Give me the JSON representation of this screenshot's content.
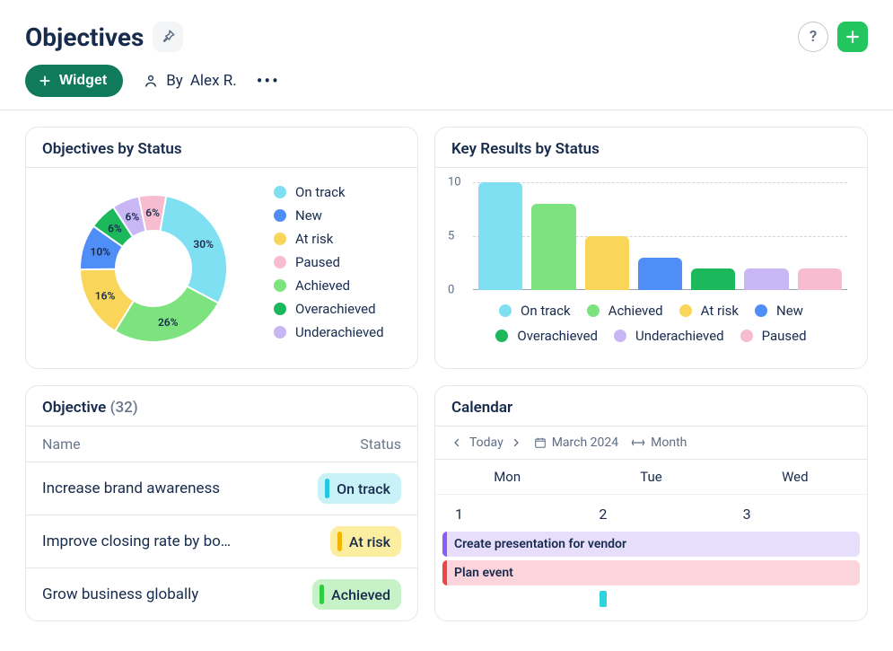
{
  "title": "Objectives",
  "toolbar": {
    "widget_label": "Widget",
    "by_prefix": "By",
    "by_user": "Alex R."
  },
  "colors": {
    "on_track": "#7ee0f0",
    "new": "#4f8df7",
    "at_risk": "#f9d65a",
    "paused": "#f7bcd0",
    "achieved": "#7ce37f",
    "overachieved": "#1cb85c",
    "underachieved": "#c9b6f5"
  },
  "pill_bg": {
    "on_track": "#c8f2f8",
    "at_risk": "#fceea0",
    "achieved": "#c7f2c8"
  },
  "pill_bar": {
    "on_track": "#22c9de",
    "at_risk": "#f5b400",
    "achieved": "#2ecc40"
  },
  "chart_data": [
    {
      "type": "pie",
      "title": "Objectives by Status",
      "series": [
        {
          "name": "On track",
          "value": 30,
          "color_key": "on_track"
        },
        {
          "name": "Achieved",
          "value": 26,
          "color_key": "achieved"
        },
        {
          "name": "At risk",
          "value": 16,
          "color_key": "at_risk"
        },
        {
          "name": "New",
          "value": 10,
          "color_key": "new"
        },
        {
          "name": "Overachieved",
          "value": 6,
          "color_key": "overachieved"
        },
        {
          "name": "Underachieved",
          "value": 6,
          "color_key": "underachieved"
        },
        {
          "name": "Paused",
          "value": 6,
          "color_key": "paused"
        }
      ],
      "legend_order": [
        "on_track",
        "new",
        "at_risk",
        "paused",
        "achieved",
        "overachieved",
        "underachieved"
      ],
      "legend_labels": {
        "on_track": "On track",
        "new": "New",
        "at_risk": "At risk",
        "paused": "Paused",
        "achieved": "Achieved",
        "overachieved": "Overachieved",
        "underachieved": "Underachieved"
      }
    },
    {
      "type": "bar",
      "title": "Key Results by Status",
      "ylim": [
        0,
        10
      ],
      "yticks": [
        0,
        5,
        10
      ],
      "series": [
        {
          "name": "On track",
          "value": 10,
          "color_key": "on_track"
        },
        {
          "name": "Achieved",
          "value": 8,
          "color_key": "achieved"
        },
        {
          "name": "At risk",
          "value": 5,
          "color_key": "at_risk"
        },
        {
          "name": "New",
          "value": 3,
          "color_key": "new"
        },
        {
          "name": "Overachieved",
          "value": 2,
          "color_key": "overachieved"
        },
        {
          "name": "Underachieved",
          "value": 2,
          "color_key": "underachieved"
        },
        {
          "name": "Paused",
          "value": 2,
          "color_key": "paused"
        }
      ]
    }
  ],
  "objective_table": {
    "title": "Objective",
    "count": 32,
    "columns": {
      "name": "Name",
      "status": "Status"
    },
    "rows": [
      {
        "name": "Increase brand awareness",
        "status_label": "On track",
        "status_key": "on_track"
      },
      {
        "name": "Improve closing rate by bo…",
        "status_label": "At risk",
        "status_key": "at_risk"
      },
      {
        "name": "Grow business globally",
        "status_label": "Achieved",
        "status_key": "achieved"
      }
    ]
  },
  "calendar": {
    "title": "Calendar",
    "today_label": "Today",
    "month_label": "March 2024",
    "range_label": "Month",
    "dow": [
      "Mon",
      "Tue",
      "Wed"
    ],
    "days": [
      "1",
      "2",
      "3"
    ],
    "events": [
      {
        "label": "Create presentation for vendor",
        "bg": "#e7defc",
        "stripe": "#8b5cf6"
      },
      {
        "label": "Plan event",
        "bg": "#fbd5db",
        "stripe": "#ef4444"
      }
    ],
    "marker_color": "#2dd4e0"
  }
}
